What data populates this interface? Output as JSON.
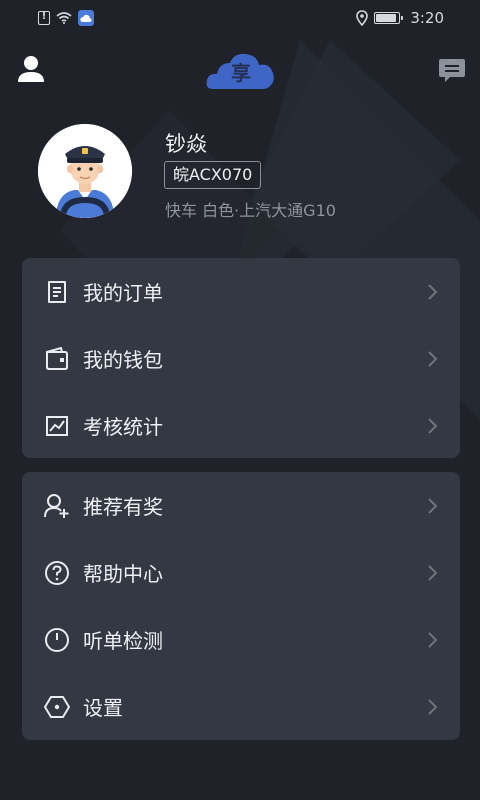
{
  "status_bar": {
    "time": "3:20",
    "battery_level": 0.9
  },
  "header": {
    "logo_text": "享"
  },
  "profile": {
    "name": "钞焱",
    "plate": "皖ACX070",
    "car_info": "快车 白色·上汽大通G10"
  },
  "menu_group_1": [
    {
      "label": "我的订单",
      "icon": "order-icon"
    },
    {
      "label": "我的钱包",
      "icon": "wallet-icon"
    },
    {
      "label": "考核统计",
      "icon": "stats-icon"
    }
  ],
  "menu_group_2": [
    {
      "label": "推荐有奖",
      "icon": "add-user-icon"
    },
    {
      "label": "帮助中心",
      "icon": "help-icon"
    },
    {
      "label": "听单检测",
      "icon": "clock-icon"
    },
    {
      "label": "设置",
      "icon": "settings-icon"
    }
  ],
  "colors": {
    "background": "#1f2229",
    "card": "#333843",
    "logo_cloud": "#3f66c7",
    "text": "#eef0f3",
    "muted": "#8f939b"
  }
}
